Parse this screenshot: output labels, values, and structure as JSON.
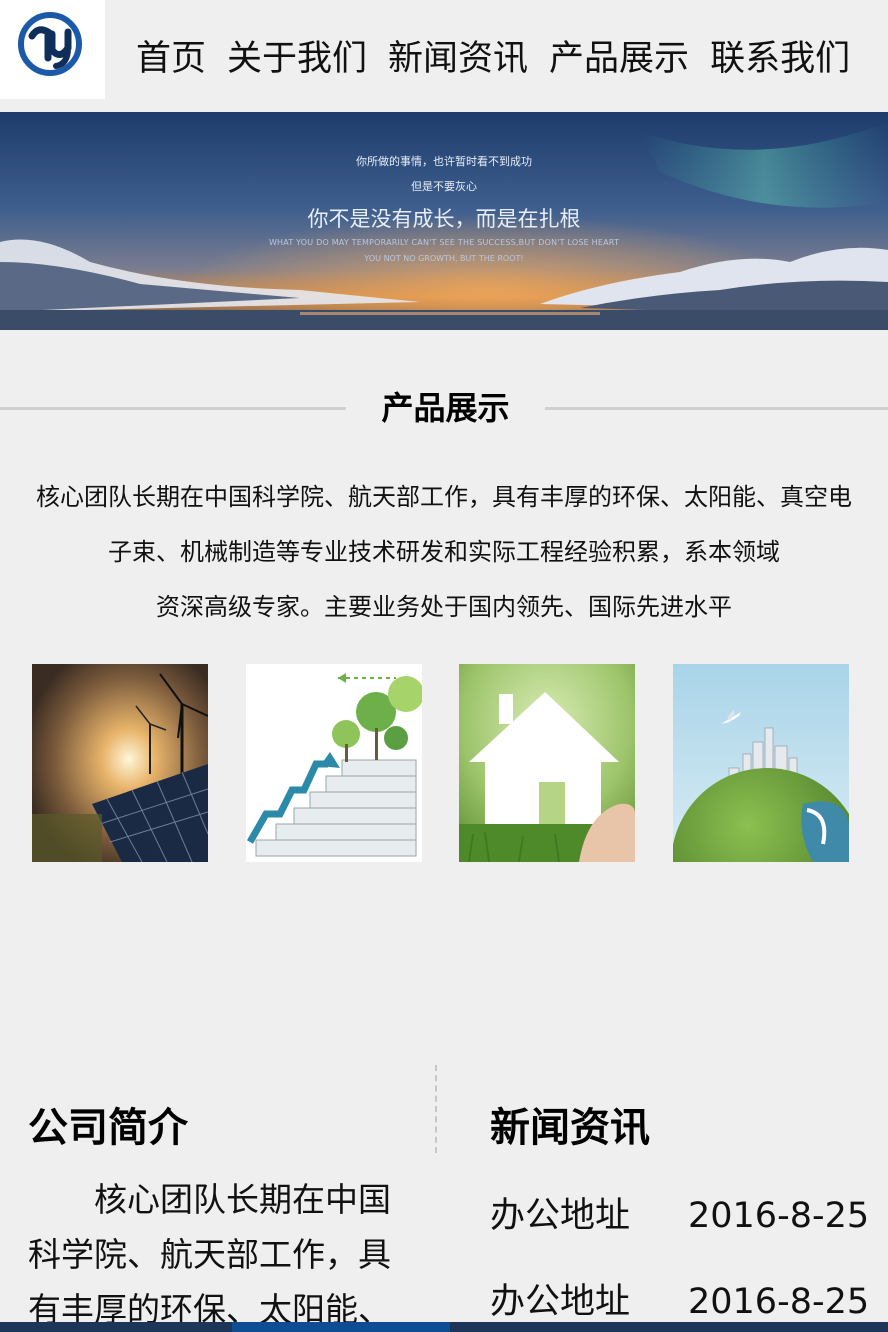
{
  "header": {
    "logo_icon": "hy-logo-icon",
    "nav": [
      "首页",
      "关于我们",
      "新闻资讯",
      "产品展示",
      "联系我们"
    ]
  },
  "banner": {
    "line1": "你所做的事情，也许暂时看不到成功",
    "line2": "但是不要灰心",
    "headline": "你不是没有成长，而是在扎根",
    "en1": "WHAT YOU DO MAY TEMPORARILY CAN'T SEE THE SUCCESS,BUT DON'T LOSE HEART",
    "en2": "YOU NOT NO GROWTH, BUT THE ROOT!"
  },
  "products": {
    "title": "产品展示",
    "intro_lines": [
      "核心团队长期在中国科学院、航天部工作，具有丰厚的环保、太阳能、真空电",
      "子束、机械制造等专业技术研发和实际工程经验积累，系本领域",
      "资深高级专家。主要业务处于国内领先、国际先进水平"
    ],
    "images": [
      "solar-panel-wind-image",
      "green-stairs-growth-image",
      "paper-house-grass-image",
      "green-globe-city-image"
    ]
  },
  "about": {
    "title": "公司简介",
    "lines": [
      "　　核心团队长期在中国",
      "科学院、航天部工作，具",
      "有丰厚的环保、太阳能、"
    ]
  },
  "news": {
    "title": "新闻资讯",
    "items": [
      {
        "label": "办公地址",
        "date": "2016-8-25"
      },
      {
        "label": "办公地址",
        "date": "2016-8-25"
      }
    ]
  },
  "colors": {
    "background": "#efefef",
    "logo_blue": "#1a5aa8",
    "bottom_bar": "#1d3557"
  }
}
